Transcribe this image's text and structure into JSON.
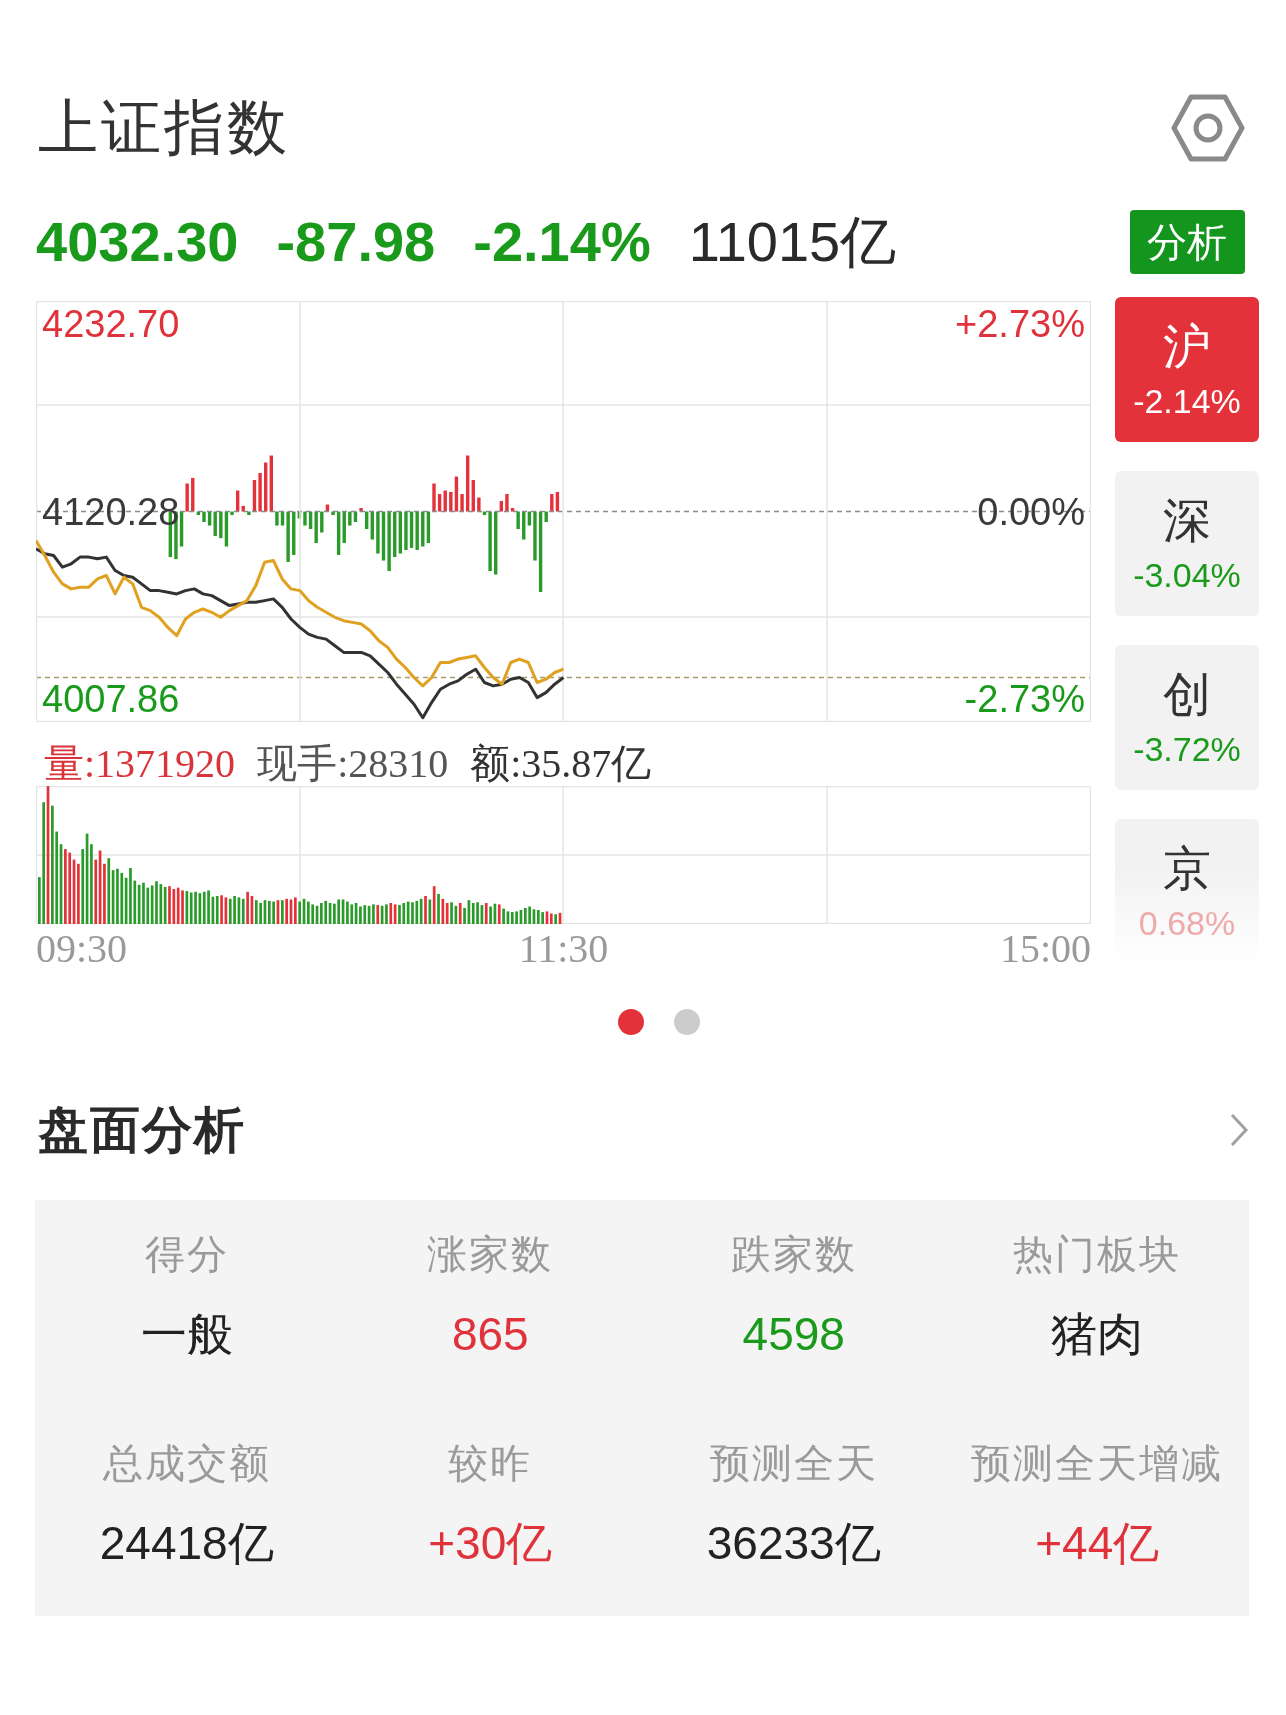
{
  "header": {
    "title": "上证指数"
  },
  "quote": [
    {
      "text": "4032.30",
      "color": "#1a9a1a"
    },
    {
      "text": "-87.98",
      "color": "#1a9a1a"
    },
    {
      "text": "-2.14%",
      "color": "#1a9a1a"
    },
    {
      "text": "11015亿",
      "color": "#2a2a2a"
    }
  ],
  "analysis_button": {
    "label": "分析"
  },
  "price_chart": {
    "chart_data": {
      "type": "line",
      "categories": [
        null,
        null,
        null,
        null,
        null,
        null,
        null,
        null,
        null,
        null,
        null,
        null,
        null,
        null,
        null,
        null,
        null,
        null,
        null,
        null,
        null,
        null,
        null,
        null,
        null,
        null,
        null,
        null,
        null,
        null,
        null,
        null,
        null,
        null,
        null,
        null,
        null,
        null,
        null,
        null,
        null,
        null,
        null,
        null,
        null,
        null,
        null,
        null,
        null,
        null,
        null,
        null,
        null,
        null,
        null,
        null,
        null,
        null,
        null,
        null,
        null,
        null,
        null,
        null,
        null,
        null,
        null,
        null,
        null,
        null,
        null,
        null,
        null,
        null,
        null,
        null,
        null,
        null,
        null,
        null,
        null,
        null,
        null,
        null,
        null,
        null,
        null,
        null,
        null,
        null,
        null,
        null,
        null,
        null,
        null,
        null,
        null,
        null,
        null,
        null,
        null,
        null,
        null,
        null,
        null,
        null,
        null,
        null,
        null,
        null,
        null,
        null,
        null,
        null,
        null,
        null,
        null,
        null,
        null,
        null,
        null
      ],
      "ylim": [
        3994.4,
        4246.2
      ],
      "yticks": [
        {
          "value": 4232.7,
          "label": "4232.70"
        },
        {
          "value": 4120.28,
          "label": "4120.28"
        },
        {
          "value": 4007.86,
          "label": "4007.86"
        }
      ],
      "series": [
        {
          "color": "#333333",
          "values": [
            4098,
            4095,
            4094,
            4087,
            4089,
            4093,
            4093,
            4092,
            4093,
            4085,
            4082,
            4081,
            4077,
            4073,
            4073,
            4072,
            4071,
            4073,
            4074,
            4071,
            4070,
            4067,
            4064,
            4065,
            4066,
            4066,
            4067,
            4068,
            4063,
            4056,
            4051,
            4047,
            4045,
            4044,
            4040,
            4036,
            4036,
            4036,
            4034,
            4029,
            4024,
            4017,
            4011,
            4005,
            3997,
            4006,
            4014,
            4017,
            4019,
            4023,
            4026,
            4018,
            4016,
            4017,
            4020,
            4021,
            4018,
            4009,
            4012,
            4017,
            4021,
            null,
            null,
            null,
            null,
            null,
            null,
            null,
            null,
            null,
            null,
            null,
            null,
            null,
            null,
            null,
            null,
            null,
            null,
            null,
            null,
            null,
            null,
            null,
            null,
            null,
            null,
            null,
            null,
            null,
            null,
            null,
            null,
            null,
            null,
            null,
            null,
            null,
            null,
            null,
            null,
            null,
            null,
            null,
            null,
            null,
            null,
            null,
            null,
            null,
            null,
            null,
            null,
            null,
            null,
            null,
            null,
            null,
            null,
            null,
            null
          ]
        },
        {
          "color": "#e0a020",
          "values": [
            4103,
            4094,
            4084,
            4077,
            4074,
            4075,
            4075,
            4080,
            4082,
            4071,
            4081,
            4077,
            4063,
            4061,
            4057,
            4051,
            4046,
            4056,
            4060,
            4062,
            4060,
            4057,
            4061,
            4064,
            4067,
            4076,
            4090,
            4091,
            4080,
            4074,
            4073,
            4067,
            4063,
            4060,
            4057,
            4055,
            4054,
            4053,
            4049,
            4043,
            4039,
            4032,
            4027,
            4021,
            4016,
            4021,
            4030,
            4030,
            4032,
            4033,
            4034,
            4027,
            4021,
            4017,
            4030,
            4032,
            4030,
            4018,
            4020,
            4024,
            4026,
            null,
            null,
            null,
            null,
            null,
            null,
            null,
            null,
            null,
            null,
            null,
            null,
            null,
            null,
            null,
            null,
            null,
            null,
            null,
            null,
            null,
            null,
            null,
            null,
            null,
            null,
            null,
            null,
            null,
            null,
            null,
            null,
            null,
            null,
            null,
            null,
            null,
            null,
            null,
            null,
            null,
            null,
            null,
            null,
            null,
            null,
            null,
            null,
            null,
            null,
            null,
            null,
            null,
            null,
            null,
            null,
            null,
            null,
            null,
            null
          ]
        }
      ]
    },
    "percent_labels": [
      {
        "text": "+2.73%",
        "color": "#e0323a"
      },
      {
        "text": "0.00%",
        "color": "#3a3a3a"
      },
      {
        "text": "-2.73%",
        "color": "#1a9a1a"
      }
    ]
  },
  "volume_info": {
    "volume": "量:1371920",
    "current_hands": "现手:28310",
    "amount": "额:35.87亿"
  },
  "time_axis": [
    "09:30",
    "11:30",
    "15:00"
  ],
  "markets": [
    {
      "name": "沪",
      "change": "-2.14%",
      "selected": true
    },
    {
      "name": "深",
      "change": "-3.04%",
      "color": "#1a9a1a",
      "selected": false
    },
    {
      "name": "创",
      "change": "-3.72%",
      "color": "#1a9a1a",
      "selected": false
    },
    {
      "name": "京",
      "change": "0.68%",
      "color": "#eeaaaa",
      "selected": false
    }
  ],
  "pages": [
    {
      "selected": true
    },
    {
      "selected": false
    }
  ],
  "section": {
    "title": "盘面分析"
  },
  "stats": [
    {
      "label": "得分",
      "value": "一般",
      "color": "#222222"
    },
    {
      "label": "涨家数",
      "value": "865",
      "color": "#e0323a"
    },
    {
      "label": "跌家数",
      "value": "4598",
      "color": "#1a9a1a"
    },
    {
      "label": "热门板块",
      "value": "猪肉",
      "color": "#222222"
    },
    {
      "label": "总成交额",
      "value": "24418亿",
      "color": "#222222"
    },
    {
      "label": "较昨",
      "value": "+30亿",
      "color": "#e0323a"
    },
    {
      "label": "预测全天",
      "value": "36233亿",
      "color": "#222222"
    },
    {
      "label": "预测全天增减",
      "value": "+44亿",
      "color": "#e0323a"
    }
  ]
}
